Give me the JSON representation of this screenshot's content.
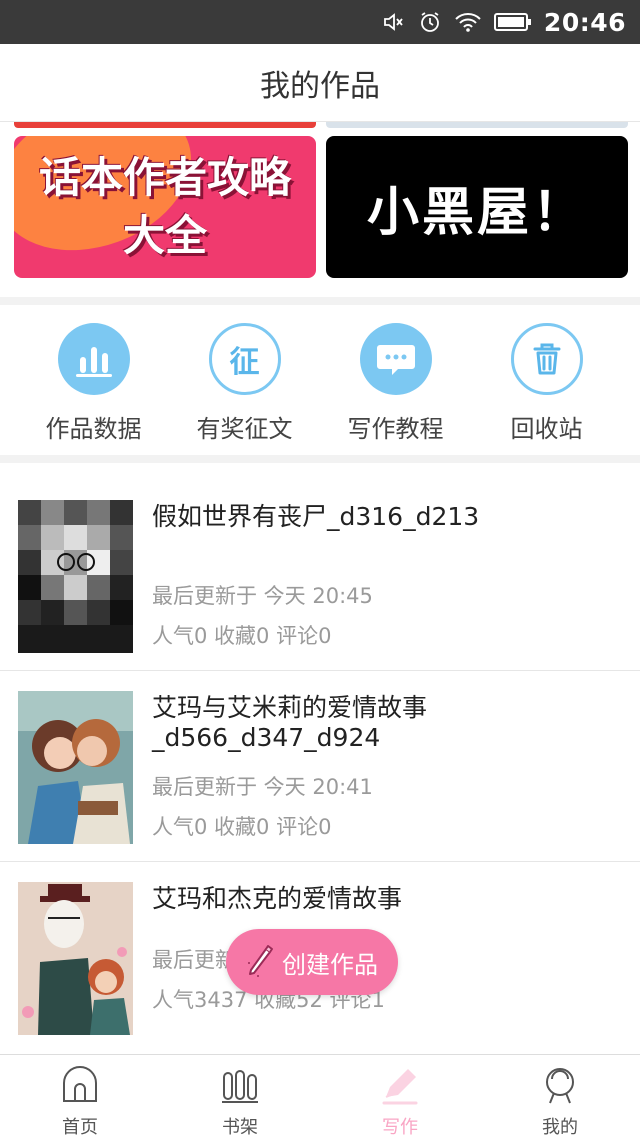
{
  "status_bar": {
    "time": "20:46",
    "icons": [
      "mute-icon",
      "alarm-icon",
      "wifi-icon",
      "battery-icon"
    ]
  },
  "header": {
    "title": "我的作品"
  },
  "banners": [
    {
      "text_line1": "话本作者攻略",
      "text_line2": "大全"
    },
    {
      "text": "小黑屋！"
    }
  ],
  "quick_menu": [
    {
      "label": "作品数据",
      "icon": "bar-chart-icon"
    },
    {
      "label": "有奖征文",
      "icon": "contest-icon",
      "icon_char": "征"
    },
    {
      "label": "写作教程",
      "icon": "chat-bubble-icon"
    },
    {
      "label": "回收站",
      "icon": "trash-icon"
    }
  ],
  "works": [
    {
      "title": "假如世界有丧尸_d316_d213",
      "updated": "最后更新于 今天 20:45",
      "stats": "人气0  收藏0  评论0"
    },
    {
      "title": "艾玛与艾米莉的爱情故事_d566_d347_d924",
      "updated": "最后更新于 今天 20:41",
      "stats": "人气0  收藏0  评论0"
    },
    {
      "title": "艾玛和杰克的爱情故事",
      "updated": "最后更新",
      "stats": "人气3437  收藏52  评论1"
    }
  ],
  "fab": {
    "label": "创建作品"
  },
  "tabs": [
    {
      "label": "首页",
      "icon": "home-icon"
    },
    {
      "label": "书架",
      "icon": "bookshelf-icon"
    },
    {
      "label": "写作",
      "icon": "pen-icon",
      "active": true
    },
    {
      "label": "我的",
      "icon": "profile-icon"
    }
  ],
  "colors": {
    "accent_pink": "#f677a6",
    "icon_blue": "#7cc8f2",
    "status_bar": "#3a3a3a"
  }
}
